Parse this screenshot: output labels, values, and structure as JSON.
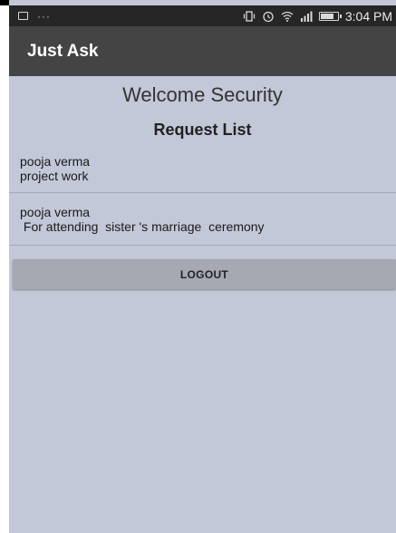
{
  "status_bar": {
    "time": "3:04 PM",
    "dots": "···",
    "icons": [
      "notification-icon",
      "vibrate-icon",
      "alarm-icon",
      "wifi-icon",
      "signal-icon",
      "battery-icon"
    ]
  },
  "app_bar": {
    "title": "Just Ask"
  },
  "main": {
    "welcome": "Welcome Security",
    "list_title": "Request List",
    "requests": [
      {
        "name": "pooja verma",
        "reason": "project work"
      },
      {
        "name": "pooja verma",
        "reason": " For attending  sister 's marriage  ceremony"
      }
    ],
    "logout_label": "LOGOUT"
  },
  "colors": {
    "background": "#c3c8d8",
    "app_bar": "#444444",
    "status_bar": "#262626",
    "button": "#a6a9b2"
  }
}
